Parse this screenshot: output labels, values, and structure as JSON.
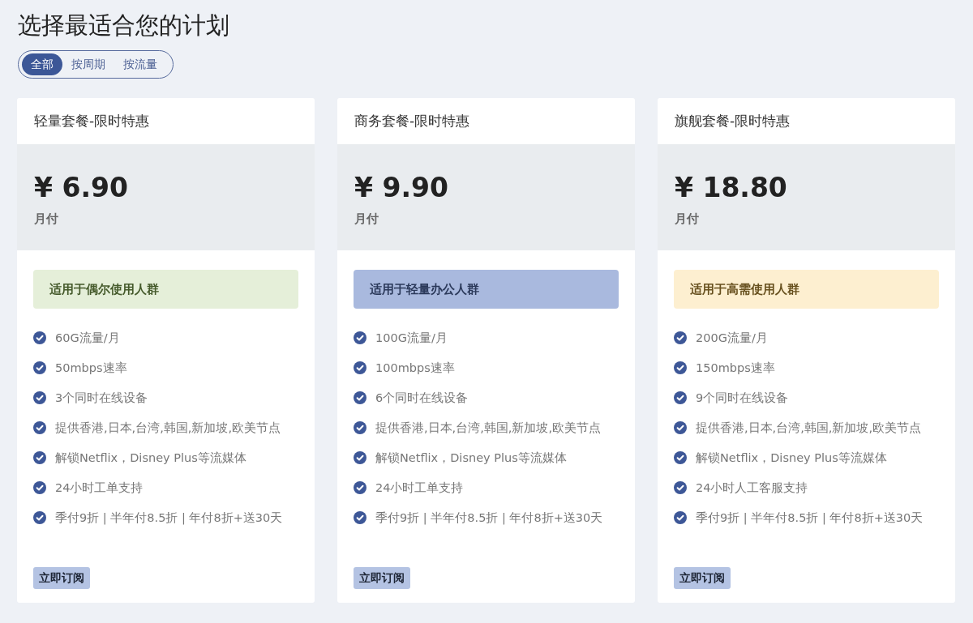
{
  "page": {
    "title": "选择最适合您的计划"
  },
  "filter_tabs": [
    {
      "label": "全部",
      "selected": true
    },
    {
      "label": "按周期",
      "selected": false
    },
    {
      "label": "按流量",
      "selected": false
    }
  ],
  "plans": [
    {
      "name": "轻量套餐-限时特惠",
      "price": "¥ 6.90",
      "period": "月付",
      "audience": {
        "text": "适用于偶尔使用人群",
        "color": "#e5efd9"
      },
      "features": [
        "60G流量/月",
        "50mbps速率",
        "3个同时在线设备",
        "提供香港,日本,台湾,韩国,新加坡,欧美节点",
        "解锁Netflix，Disney Plus等流媒体",
        "24小时工单支持",
        "季付9折 | 半年付8.5折 | 年付8折+送30天"
      ],
      "button": "立即订阅"
    },
    {
      "name": "商务套餐-限时特惠",
      "price": "¥ 9.90",
      "period": "月付",
      "audience": {
        "text": "适用于轻量办公人群",
        "color": "#a9b9de"
      },
      "features": [
        "100G流量/月",
        "100mbps速率",
        "6个同时在线设备",
        "提供香港,日本,台湾,韩国,新加坡,欧美节点",
        "解锁Netflix，Disney Plus等流媒体",
        "24小时工单支持",
        "季付9折 | 半年付8.5折 | 年付8折+送30天"
      ],
      "button": "立即订阅"
    },
    {
      "name": "旗舰套餐-限时特惠",
      "price": "¥ 18.80",
      "period": "月付",
      "audience": {
        "text": "适用于高需使用人群",
        "color": "#fdefd0"
      },
      "features": [
        "200G流量/月",
        "150mbps速率",
        "9个同时在线设备",
        "提供香港,日本,台湾,韩国,新加坡,欧美节点",
        "解锁Netflix，Disney Plus等流媒体",
        "24小时人工客服支持",
        "季付9折 | 半年付8.5折 | 年付8折+送30天"
      ],
      "button": "立即订阅"
    }
  ]
}
